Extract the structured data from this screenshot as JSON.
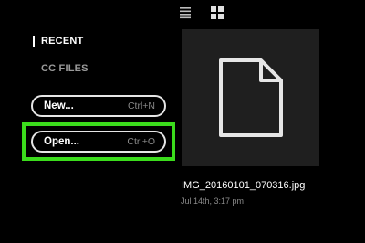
{
  "toolbar": {
    "list_view_icon": "list-view-icon",
    "grid_view_icon": "grid-view-icon"
  },
  "sidebar": {
    "items": [
      {
        "label": "RECENT",
        "active": true
      },
      {
        "label": "CC FILES",
        "active": false
      }
    ]
  },
  "actions": {
    "new": {
      "label": "New...",
      "shortcut": "Ctrl+N"
    },
    "open": {
      "label": "Open...",
      "shortcut": "Ctrl+O"
    }
  },
  "highlight_color": "#3bdc1c",
  "file": {
    "icon": "document-icon",
    "name": "IMG_20160101_070316.jpg",
    "date": "Jul 14th, 3:17 pm"
  }
}
